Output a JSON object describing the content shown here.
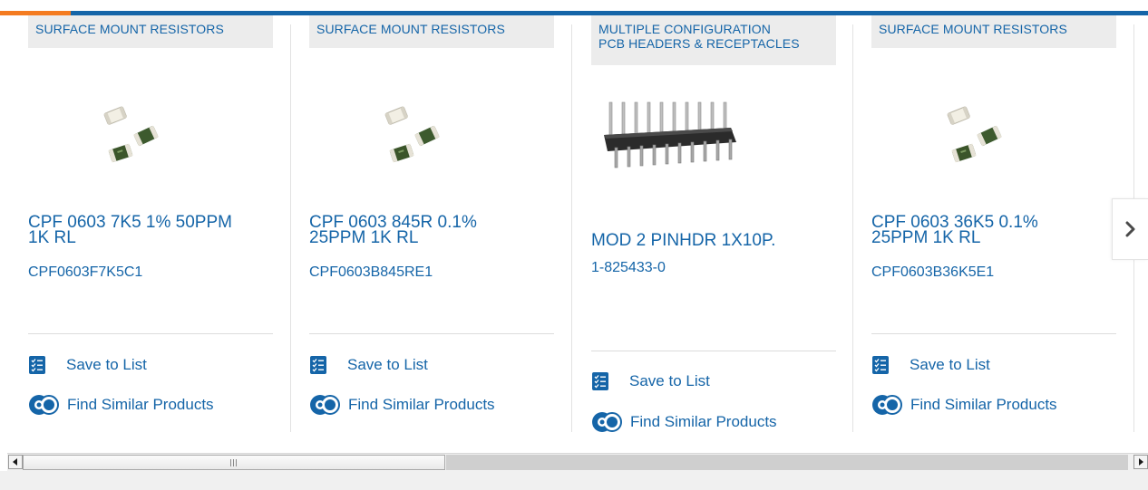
{
  "products": [
    {
      "category": "SURFACE MOUNT RESISTORS",
      "title_line1": "CPF 0603 7K5 1% 50PPM",
      "title_line2": "1K RL",
      "part_number": "CPF0603F7K5C1",
      "save_label": "Save to List",
      "similar_label": "Find Similar Products",
      "image_icon": "smd-resistor-image"
    },
    {
      "category": "SURFACE MOUNT RESISTORS",
      "title_line1": "CPF 0603 845R 0.1%",
      "title_line2": "25PPM 1K RL",
      "part_number": "CPF0603B845RE1",
      "save_label": "Save to List",
      "similar_label": "Find Similar Products",
      "image_icon": "smd-resistor-image"
    },
    {
      "category_line1": "MULTIPLE CONFIGURATION",
      "category_line2": "PCB HEADERS & RECEPTACLES",
      "title_line1": "MOD 2 PINHDR 1X10P.",
      "part_number": "1-825433-0",
      "save_label": "Save to List",
      "similar_label": "Find Similar Products",
      "image_icon": "pin-header-image"
    },
    {
      "category": "SURFACE MOUNT RESISTORS",
      "title_line1": "CPF 0603 36K5 0.1%",
      "title_line2": "25PPM 1K RL",
      "part_number": "CPF0603B36K5E1",
      "save_label": "Save to List",
      "similar_label": "Find Similar Products",
      "image_icon": "smd-resistor-image"
    }
  ],
  "colors": {
    "link_blue": "#1565a8",
    "accent_orange": "#f47b20",
    "category_bg": "#ececec"
  },
  "navigation": {
    "next_icon": "chevron-right-icon"
  }
}
